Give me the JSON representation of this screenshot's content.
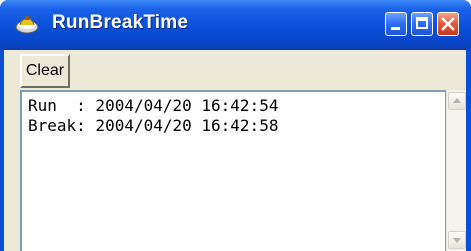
{
  "window": {
    "title": "RunBreakTime",
    "titlebar_color": "#0a4fd8",
    "controls": {
      "minimize_icon": "minimize-icon",
      "maximize_icon": "maximize-icon",
      "close_icon": "close-icon"
    }
  },
  "toolbar": {
    "clear_label": "Clear"
  },
  "log": {
    "lines": [
      "Run  : 2004/04/20 16:42:54",
      "Break: 2004/04/20 16:42:58"
    ]
  },
  "colors": {
    "close_button": "#e0573a",
    "client_background": "#ece9d8"
  }
}
